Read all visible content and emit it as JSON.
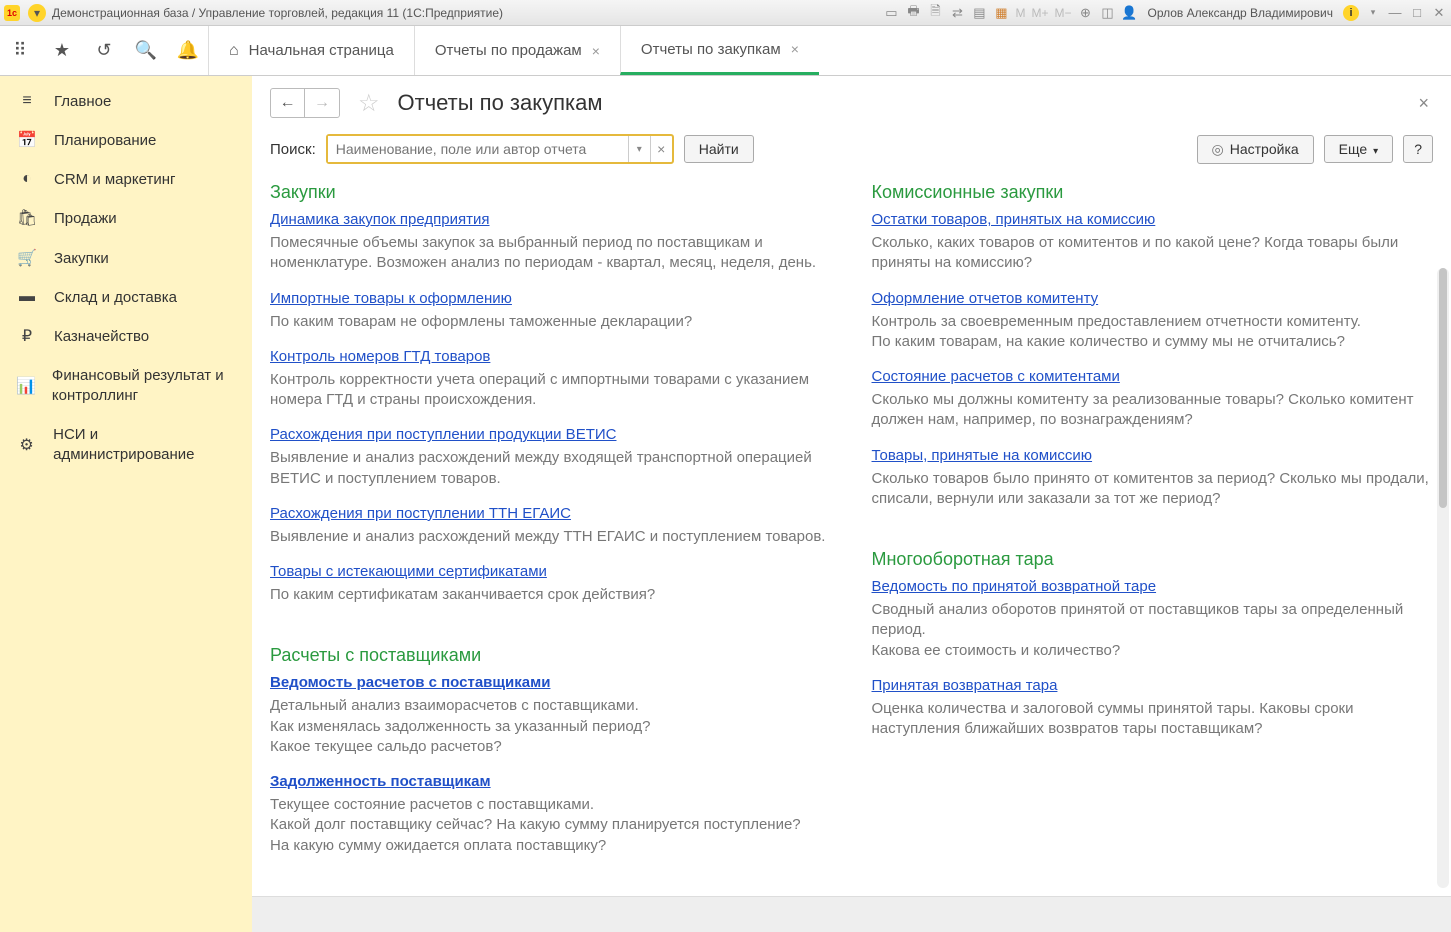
{
  "titlebar": {
    "title": "Демонстрационная база / Управление торговлей, редакция 11 (1С:Предприятие)",
    "user": "Орлов Александр Владимирович"
  },
  "tabs": {
    "home": "Начальная страница",
    "t1": "Отчеты по продажам",
    "t2": "Отчеты по закупкам"
  },
  "sidebar": {
    "main": "Главное",
    "planning": "Планирование",
    "crm": "CRM и маркетинг",
    "sales": "Продажи",
    "purchases": "Закупки",
    "warehouse": "Склад и доставка",
    "treasury": "Казначейство",
    "finresult": "Финансовый результат и контроллинг",
    "nsi": "НСИ и администрирование"
  },
  "page": {
    "title": "Отчеты по закупкам",
    "search_label": "Поиск:",
    "search_placeholder": "Наименование, поле или автор отчета",
    "find": "Найти",
    "settings": "Настройка",
    "more": "Еще",
    "help": "?"
  },
  "sections": {
    "left": [
      {
        "title": "Закупки",
        "reports": [
          {
            "link": "Динамика закупок предприятия",
            "desc": "Помесячные объемы закупок за выбранный период по поставщикам и номенклатуре. Возможен анализ по периодам - квартал, месяц, неделя, день."
          },
          {
            "link": "Импортные товары к оформлению",
            "desc": "По каким товарам не оформлены таможенные декларации?"
          },
          {
            "link": "Контроль номеров ГТД товаров",
            "desc": "Контроль корректности учета операций с импортными товарами с указанием номера ГТД и страны происхождения."
          },
          {
            "link": "Расхождения при поступлении продукции ВЕТИС",
            "desc": "Выявление и анализ расхождений между входящей транспортной операцией ВЕТИС и поступлением товаров."
          },
          {
            "link": "Расхождения при поступлении ТТН ЕГАИС",
            "desc": "Выявление и анализ расхождений между ТТН ЕГАИС и поступлением товаров."
          },
          {
            "link": "Товары с истекающими сертификатами",
            "desc": "По каким сертификатам заканчивается срок действия?"
          }
        ]
      },
      {
        "title": "Расчеты с поставщиками",
        "reports": [
          {
            "link": "Ведомость расчетов с поставщиками",
            "bold": true,
            "desc": "Детальный анализ взаиморасчетов с поставщиками.\nКак изменялась задолженность за указанный период?\nКакое текущее сальдо расчетов?"
          },
          {
            "link": "Задолженность поставщикам",
            "bold": true,
            "desc": "Текущее состояние расчетов с поставщиками.\nКакой долг поставщику сейчас? На какую сумму планируется поступление?\nНа какую сумму ожидается оплата поставщику?"
          }
        ]
      }
    ],
    "right": [
      {
        "title": "Комиссионные закупки",
        "reports": [
          {
            "link": "Остатки товаров, принятых на комиссию",
            "desc": "Сколько, каких товаров от комитентов и по какой цене? Когда товары были приняты на комиссию?"
          },
          {
            "link": "Оформление отчетов комитенту",
            "desc": "Контроль за своевременным предоставлением отчетности комитенту.\nПо каким товарам, на какие количество и сумму мы не отчитались?"
          },
          {
            "link": "Состояние расчетов с комитентами",
            "desc": "Сколько мы должны комитенту за реализованные товары? Сколько комитент должен нам, например, по вознаграждениям?"
          },
          {
            "link": "Товары, принятые на комиссию",
            "desc": "Сколько товаров было принято от комитентов за период? Сколько мы продали, списали, вернули или заказали за тот же период?"
          }
        ]
      },
      {
        "title": "Многооборотная тара",
        "reports": [
          {
            "link": "Ведомость по принятой возвратной таре",
            "desc": "Сводный анализ оборотов принятой от поставщиков тары за определенный период.\nКакова ее стоимость и количество?"
          },
          {
            "link": "Принятая возвратная тара",
            "desc": "Оценка количества и залоговой суммы принятой тары. Каковы сроки наступления ближайших возвратов тары поставщикам?"
          }
        ]
      }
    ]
  }
}
